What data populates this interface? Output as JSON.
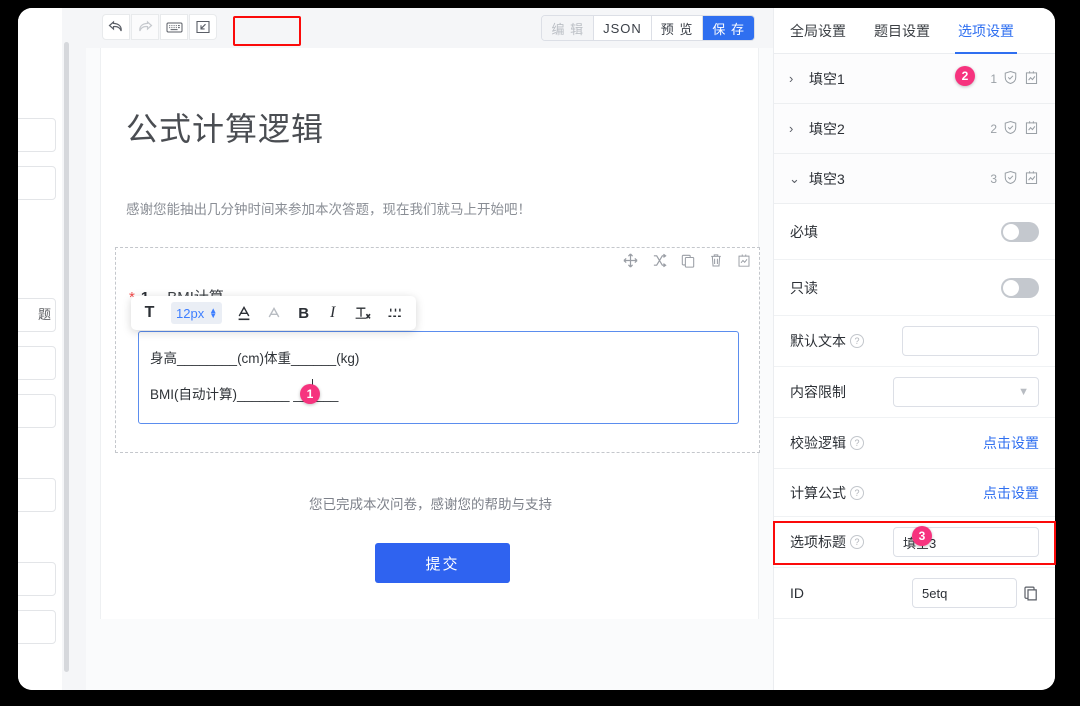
{
  "toolbar": {
    "undo_icon": "undo-arrow-icon",
    "redo_icon": "redo-arrow-icon",
    "keyboard_icon": "keyboard-icon",
    "import_icon": "import-icon",
    "segments": [
      {
        "label": "编 辑",
        "state": "disabled"
      },
      {
        "label": "JSON",
        "state": "normal"
      },
      {
        "label": "预 览",
        "state": "normal"
      },
      {
        "label": "保 存",
        "state": "primary"
      }
    ]
  },
  "paper": {
    "title": "公式计算逻辑",
    "subtitle": "感谢您能抽出几分钟时间来参加本次答题，现在我们就马上开始吧！",
    "question": {
      "required_mark": "*",
      "number": "1",
      "title": "BMI计算",
      "actions": [
        "move-icon",
        "shuffle-icon",
        "copy-icon",
        "delete-icon",
        "logic-icon"
      ],
      "richtext": {
        "text_tool": "T",
        "font_size": "12px",
        "underline": "A",
        "highlight": "A",
        "bold": "B",
        "italic": "I",
        "clear_format": "Tx",
        "blank_tool": "blank-icon"
      },
      "body_line1": "身高________(cm)体重______(kg)",
      "body_line2": "BMI(自动计算)_______ ______"
    },
    "footer_text": "您已完成本次问卷，感谢您的帮助与支持",
    "submit_label": "提交"
  },
  "panel": {
    "tabs": [
      {
        "label": "全局设置",
        "active": false
      },
      {
        "label": "题目设置",
        "active": false
      },
      {
        "label": "选项设置",
        "active": true
      }
    ],
    "accordion": [
      {
        "label": "填空1",
        "count": "1",
        "expanded": false,
        "chevron": "›"
      },
      {
        "label": "填空2",
        "count": "2",
        "expanded": false,
        "chevron": "›"
      },
      {
        "label": "填空3",
        "count": "3",
        "expanded": true,
        "chevron": "⌄"
      }
    ],
    "settings": {
      "required_label": "必填",
      "required_value": "off",
      "readonly_label": "只读",
      "readonly_value": "off",
      "default_text_label": "默认文本",
      "default_text_value": "",
      "content_limit_label": "内容限制",
      "content_limit_value": "",
      "validate_logic_label": "校验逻辑",
      "validate_logic_link": "点击设置",
      "formula_label": "计算公式",
      "formula_link": "点击设置",
      "option_title_label": "选项标题",
      "option_title_value": "填空3",
      "id_label": "ID",
      "id_value": "5etq",
      "copy_icon": "copy-icon"
    }
  },
  "annotations": {
    "badge1": "1",
    "badge2": "2",
    "badge3": "3",
    "highlight_color": "#fb0a0a",
    "badge_color": "#f6337e"
  },
  "leftstrip": {
    "partial_label": "题"
  },
  "colors": {
    "primary": "#2f6ff0",
    "submit": "#2f63f0",
    "required": "#f04a4a"
  }
}
